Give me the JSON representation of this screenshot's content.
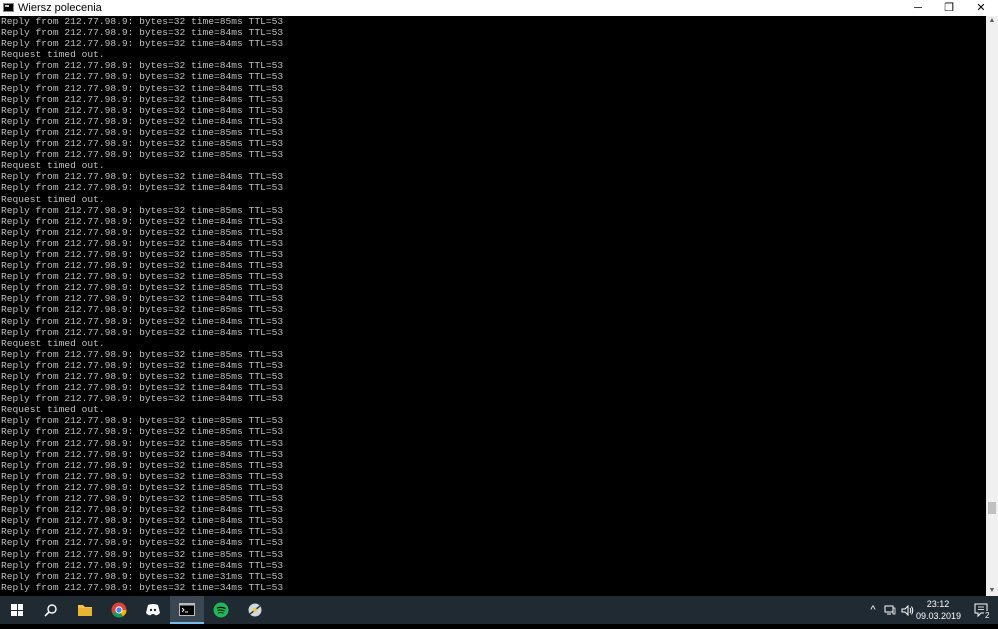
{
  "window": {
    "title": "Wiersz polecenia",
    "controls": {
      "minimize": "─",
      "restore": "❐",
      "close": "✕"
    }
  },
  "console_lines": [
    "Reply from 212.77.98.9: bytes=32 time=85ms TTL=53",
    "Reply from 212.77.98.9: bytes=32 time=84ms TTL=53",
    "Reply from 212.77.98.9: bytes=32 time=84ms TTL=53",
    "Request timed out.",
    "Reply from 212.77.98.9: bytes=32 time=84ms TTL=53",
    "Reply from 212.77.98.9: bytes=32 time=84ms TTL=53",
    "Reply from 212.77.98.9: bytes=32 time=84ms TTL=53",
    "Reply from 212.77.98.9: bytes=32 time=84ms TTL=53",
    "Reply from 212.77.98.9: bytes=32 time=84ms TTL=53",
    "Reply from 212.77.98.9: bytes=32 time=84ms TTL=53",
    "Reply from 212.77.98.9: bytes=32 time=85ms TTL=53",
    "Reply from 212.77.98.9: bytes=32 time=85ms TTL=53",
    "Reply from 212.77.98.9: bytes=32 time=85ms TTL=53",
    "Request timed out.",
    "Reply from 212.77.98.9: bytes=32 time=84ms TTL=53",
    "Reply from 212.77.98.9: bytes=32 time=84ms TTL=53",
    "Request timed out.",
    "Reply from 212.77.98.9: bytes=32 time=85ms TTL=53",
    "Reply from 212.77.98.9: bytes=32 time=84ms TTL=53",
    "Reply from 212.77.98.9: bytes=32 time=85ms TTL=53",
    "Reply from 212.77.98.9: bytes=32 time=84ms TTL=53",
    "Reply from 212.77.98.9: bytes=32 time=85ms TTL=53",
    "Reply from 212.77.98.9: bytes=32 time=84ms TTL=53",
    "Reply from 212.77.98.9: bytes=32 time=85ms TTL=53",
    "Reply from 212.77.98.9: bytes=32 time=85ms TTL=53",
    "Reply from 212.77.98.9: bytes=32 time=84ms TTL=53",
    "Reply from 212.77.98.9: bytes=32 time=85ms TTL=53",
    "Reply from 212.77.98.9: bytes=32 time=84ms TTL=53",
    "Reply from 212.77.98.9: bytes=32 time=84ms TTL=53",
    "Request timed out.",
    "Reply from 212.77.98.9: bytes=32 time=85ms TTL=53",
    "Reply from 212.77.98.9: bytes=32 time=84ms TTL=53",
    "Reply from 212.77.98.9: bytes=32 time=85ms TTL=53",
    "Reply from 212.77.98.9: bytes=32 time=84ms TTL=53",
    "Reply from 212.77.98.9: bytes=32 time=84ms TTL=53",
    "Request timed out.",
    "Reply from 212.77.98.9: bytes=32 time=85ms TTL=53",
    "Reply from 212.77.98.9: bytes=32 time=85ms TTL=53",
    "Reply from 212.77.98.9: bytes=32 time=85ms TTL=53",
    "Reply from 212.77.98.9: bytes=32 time=84ms TTL=53",
    "Reply from 212.77.98.9: bytes=32 time=85ms TTL=53",
    "Reply from 212.77.98.9: bytes=32 time=83ms TTL=53",
    "Reply from 212.77.98.9: bytes=32 time=85ms TTL=53",
    "Reply from 212.77.98.9: bytes=32 time=85ms TTL=53",
    "Reply from 212.77.98.9: bytes=32 time=84ms TTL=53",
    "Reply from 212.77.98.9: bytes=32 time=84ms TTL=53",
    "Reply from 212.77.98.9: bytes=32 time=84ms TTL=53",
    "Reply from 212.77.98.9: bytes=32 time=84ms TTL=53",
    "Reply from 212.77.98.9: bytes=32 time=85ms TTL=53",
    "Reply from 212.77.98.9: bytes=32 time=84ms TTL=53",
    "Reply from 212.77.98.9: bytes=32 time=31ms TTL=53",
    "Reply from 212.77.98.9: bytes=32 time=34ms TTL=53"
  ],
  "taskbar": {
    "apps": [
      {
        "name": "start",
        "icon": "windows-logo-icon"
      },
      {
        "name": "search",
        "icon": "search-icon"
      },
      {
        "name": "file-explorer",
        "icon": "folder-icon"
      },
      {
        "name": "chrome",
        "icon": "chrome-icon"
      },
      {
        "name": "discord",
        "icon": "discord-icon"
      },
      {
        "name": "command-prompt",
        "icon": "terminal-icon",
        "active": true
      },
      {
        "name": "spotify",
        "icon": "spotify-icon"
      },
      {
        "name": "app",
        "icon": "app-icon"
      }
    ],
    "tray": {
      "chevron": "^",
      "network": "network-icon",
      "volume": "volume-icon",
      "time": "23:12",
      "date": "09.03.2019",
      "notifications_count": "2"
    }
  },
  "colors": {
    "console_bg": "#000000",
    "console_text": "#c0c0c0",
    "taskbar_bg": "#1f2a33",
    "accent": "#76b9ed"
  }
}
